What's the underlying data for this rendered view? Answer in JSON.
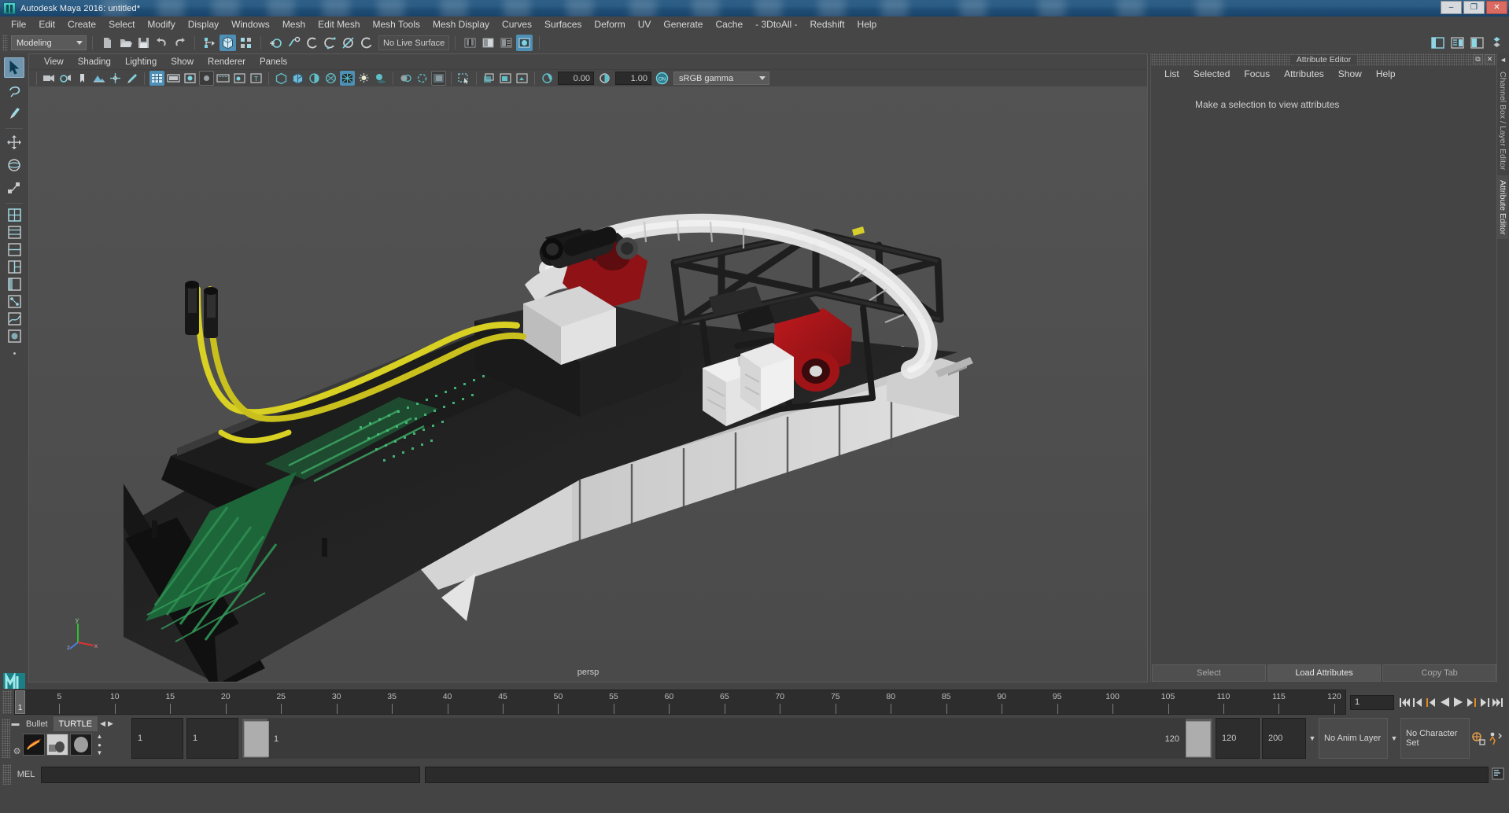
{
  "window": {
    "title": "Autodesk Maya 2016: untitled*",
    "app_icon": "maya-icon",
    "controls": {
      "minimize": "–",
      "restore": "❐",
      "close": "✕"
    }
  },
  "menubar": {
    "items": [
      "File",
      "Edit",
      "Create",
      "Select",
      "Modify",
      "Display",
      "Windows",
      "Mesh",
      "Edit Mesh",
      "Mesh Tools",
      "Mesh Display",
      "Curves",
      "Surfaces",
      "Deform",
      "UV",
      "Generate",
      "Cache",
      "- 3DtoAll -",
      "Redshift",
      "Help"
    ]
  },
  "statusbar": {
    "mode": "Modeling",
    "live_surface": "No Live Surface",
    "icon_groups": [
      {
        "name": "file-ops",
        "icons": [
          "new-scene-icon",
          "open-scene-icon",
          "save-scene-icon",
          "undo-icon",
          "redo-icon"
        ]
      },
      {
        "name": "selection-mode",
        "icons": [
          "select-by-hierarchy-icon",
          "select-by-object-icon",
          "select-by-component-icon"
        ],
        "active_index": 1
      },
      {
        "name": "snap-modes",
        "icons": [
          "snap-to-grid-icon",
          "snap-to-curve-icon",
          "snap-to-point-icon",
          "snap-to-projected-center-icon",
          "snap-to-view-plane-icon",
          "make-live-icon"
        ]
      },
      {
        "name": "editors",
        "icons": [
          "attribute-editor-icon",
          "tool-settings-icon",
          "channel-box-icon",
          "render-view-icon"
        ],
        "active_index": 3
      }
    ],
    "right_icons": [
      "show-hide-sidebar-icon",
      "toggle-attribute-editor-icon",
      "toggle-channel-box-icon",
      "toggle-layer-editor-icon"
    ]
  },
  "toolbox": {
    "tools": [
      {
        "name": "select-tool",
        "icon": "arrow-cursor-icon",
        "selected": true
      },
      {
        "name": "lasso-tool",
        "icon": "lasso-icon",
        "selected": false
      },
      {
        "name": "paint-select-tool",
        "icon": "paint-brush-icon",
        "selected": false
      },
      {
        "name": "move-tool",
        "icon": "move-arrows-icon",
        "selected": false
      },
      {
        "name": "rotate-tool",
        "icon": "rotate-circle-icon",
        "selected": false
      },
      {
        "name": "scale-tool",
        "icon": "scale-box-icon",
        "selected": false
      }
    ],
    "layouts": [
      {
        "name": "layout-single-perspective",
        "icon": "layout-single-icon"
      },
      {
        "name": "layout-four-view",
        "icon": "layout-four-view-icon"
      },
      {
        "name": "layout-two-stacked",
        "icon": "layout-two-stacked-icon"
      },
      {
        "name": "layout-three-split",
        "icon": "layout-three-split-icon"
      },
      {
        "name": "layout-outliner-persp",
        "icon": "layout-outliner-persp-icon"
      },
      {
        "name": "layout-hypergraph",
        "icon": "layout-hypergraph-icon"
      },
      {
        "name": "layout-persp-graph",
        "icon": "layout-persp-graph-icon"
      },
      {
        "name": "layout-hypershade",
        "icon": "layout-hypershade-icon"
      },
      {
        "name": "layout-more",
        "icon": "ellipsis-icon"
      }
    ]
  },
  "viewport": {
    "menus": [
      "View",
      "Shading",
      "Lighting",
      "Show",
      "Renderer",
      "Panels"
    ],
    "camera_label": "persp",
    "exposure": "0.00",
    "gamma": "1.00",
    "color_management": "sRGB gamma",
    "color_management_toggle": "ON",
    "toolbar_icons": [
      "select-camera-icon",
      "camera-attributes-icon",
      "bookmark-icon",
      "image-plane-icon",
      "two-dimensional-pan-zoom-icon",
      "grease-pencil-icon",
      "grid-toggle-icon",
      "film-gate-icon",
      "resolution-gate-icon",
      "gate-mask-icon",
      "film-origin-icon",
      "xray-icon",
      "texture-display-icon",
      "wireframe-shading-icon",
      "smooth-shade-all-icon",
      "smooth-shade-selected-icon",
      "flat-shade-icon",
      "wireframe-on-shaded-icon",
      "textured-icon",
      "use-all-lights-icon",
      "shadows-icon",
      "screen-space-ambient-occlusion-icon",
      "motion-blur-icon",
      "multisample-anti-aliasing-icon",
      "depth-of-field-icon",
      "isolate-select-icon",
      "xray-joints-icon",
      "xray-active-components-icon",
      "exposure-icon",
      "gamma-icon"
    ],
    "active_toolbar_icons": [
      "grid-toggle-icon",
      "smooth-shade-all-icon"
    ],
    "axis_labels": {
      "x": "x",
      "y": "y",
      "z": "z"
    }
  },
  "attribute_editor": {
    "panel_title": "Attribute Editor",
    "menus": [
      "List",
      "Selected",
      "Focus",
      "Attributes",
      "Show",
      "Help"
    ],
    "empty_message": "Make a selection to view attributes",
    "buttons": [
      {
        "label": "Select",
        "enabled": false
      },
      {
        "label": "Load Attributes",
        "enabled": true
      },
      {
        "label": "Copy Tab",
        "enabled": false
      }
    ],
    "window_controls": {
      "undock": "⧉",
      "close": "✕"
    }
  },
  "right_dock": {
    "tabs": [
      "Channel Box / Layer Editor",
      "Attribute Editor"
    ],
    "active_tab": "Attribute Editor",
    "collapse_icon": "chevron-left-icon"
  },
  "time_slider": {
    "current_frame": "1",
    "start": 1,
    "end": 120,
    "tick_labels": [
      5,
      10,
      15,
      20,
      25,
      30,
      35,
      40,
      45,
      50,
      55,
      60,
      65,
      70,
      75,
      80,
      85,
      90,
      95,
      100,
      105,
      110,
      115,
      120
    ],
    "frame_field": "1",
    "playback_buttons": [
      "go-to-start-icon",
      "step-back-key-icon",
      "step-back-frame-icon",
      "play-backwards-icon",
      "play-forwards-icon",
      "step-forward-frame-icon",
      "step-forward-key-icon",
      "go-to-end-icon"
    ]
  },
  "range_slider": {
    "anim_start": "1",
    "range_start": "1",
    "range_slider_left_label": "1",
    "range_slider_right_label": "120",
    "range_end": "120",
    "anim_end": "200",
    "anim_layer": "No Anim Layer",
    "character_set": "No Character Set",
    "icons": [
      "auto-keyframe-icon",
      "animation-preferences-icon"
    ]
  },
  "shelf": {
    "tabs": [
      "Bullet",
      "TURTLE"
    ],
    "active_tab": "TURTLE",
    "nav_icons": [
      "shelf-prev-icon",
      "shelf-next-icon"
    ],
    "collapse_icon": "shelf-collapse-icon",
    "options_icon": "shelf-options-gear-icon",
    "items": [
      "turtle-render-icon",
      "turtle-bake-icon",
      "turtle-material-icon"
    ],
    "scroll_icons": [
      "shelf-scroll-up-icon",
      "shelf-scroll-down-icon"
    ]
  },
  "command_line": {
    "language_label": "MEL",
    "input_value": "",
    "input_placeholder": "",
    "output_value": "",
    "icons": [
      "script-editor-icon"
    ]
  },
  "colors": {
    "accent": "#4d8fb5",
    "panel_bg": "#444444",
    "viewport_bg": "#4d4d4d",
    "title_blue": "#2b5c85",
    "field_bg": "#2b2b2b",
    "text": "#d6d6d6"
  }
}
